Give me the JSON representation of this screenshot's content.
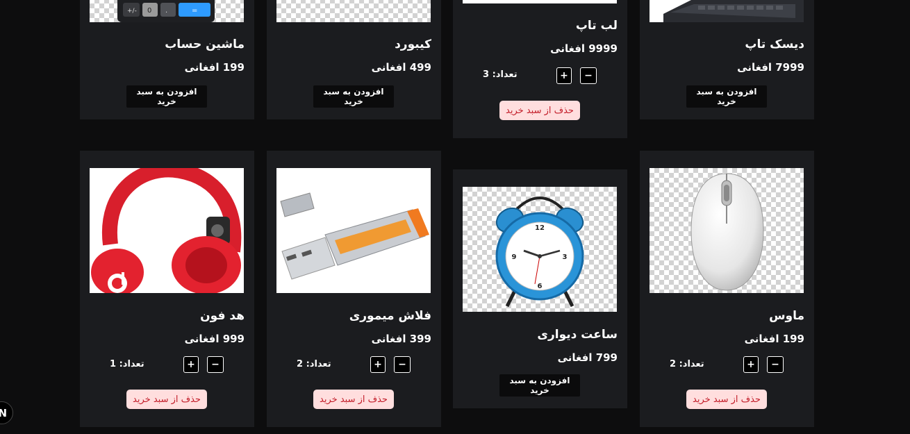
{
  "labels": {
    "add_to_cart": "افزودن به سبد خرید",
    "remove_from_cart": "حذف از سبد خرید",
    "plus": "+",
    "minus": "−"
  },
  "products": [
    {
      "name": "دیسک تاپ",
      "price": "7999 افغانی",
      "in_cart": false,
      "image": "desktop-keyboard-image"
    },
    {
      "name": "لب تاپ",
      "price": "9999 افغانی",
      "in_cart": true,
      "quantity": "تعداد: 3",
      "image": "laptop-image"
    },
    {
      "name": "کیبورد",
      "price": "499 افغانی",
      "in_cart": false,
      "image": "keyboard-image"
    },
    {
      "name": "ماشین حساب",
      "price": "199 افغانی",
      "in_cart": false,
      "image": "calculator-image"
    },
    {
      "name": "ماوس",
      "price": "199 افغانی",
      "in_cart": true,
      "quantity": "تعداد: 2",
      "image": "mouse-image"
    },
    {
      "name": "ساعت دیواری",
      "price": "799 افغانی",
      "in_cart": false,
      "image": "alarm-clock-image"
    },
    {
      "name": "فلاش میموری",
      "price": "399 افغانی",
      "in_cart": true,
      "quantity": "تعداد: 2",
      "image": "usb-flash-image"
    },
    {
      "name": "هد فون",
      "price": "999 افغانی",
      "in_cart": true,
      "quantity": "تعداد: 1",
      "image": "headphones-image"
    }
  ],
  "corner_badge": "N",
  "colors": {
    "page_bg": "#0d0d0e",
    "card_bg": "#1b1c1f",
    "remove_bg": "#ffdede",
    "remove_text": "#c31e2a"
  }
}
